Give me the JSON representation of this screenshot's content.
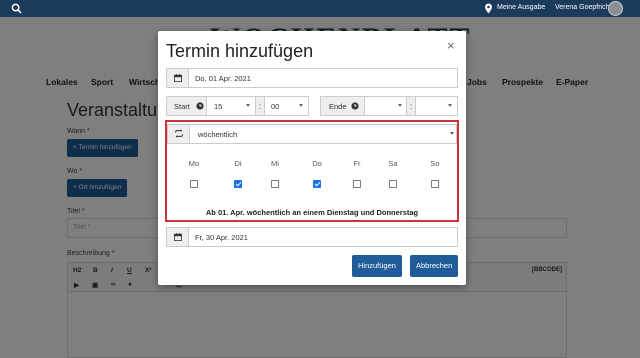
{
  "topbar": {
    "ausgabe": "Meine Ausgabe",
    "user": "Verena Goepfrich"
  },
  "site": {
    "logo": "WOCHENBLATT"
  },
  "nav": [
    "Lokales",
    "Sport",
    "Wirtsch",
    "Jobs",
    "Prospekte",
    "E-Paper"
  ],
  "page": {
    "heading": "Veranstaltu",
    "wann_label": "Wann *",
    "termin_button": "+ Termin hinzufügen",
    "wo_label": "Wo *",
    "ort_button": "+ Ort hinzufügen",
    "titel_label": "Titel *",
    "titel_placeholder": "Titel *",
    "beschreibung_label": "Beschreibung *",
    "editor": {
      "h2": "H2",
      "bold": "B",
      "italic": "I",
      "underline": "U",
      "superscript": "X²",
      "bbcode": "[BBCODE]"
    }
  },
  "modal": {
    "title": "Termin hinzufügen",
    "close": "×",
    "date": "Do, 01 Apr. 2021",
    "start_label": "Start",
    "start_hour": "15",
    "start_minute": "00",
    "time_sep": ":",
    "end_label": "Ende",
    "end_hour": "",
    "end_minute": "",
    "recurrence": "wöchentlich",
    "days": [
      {
        "label": "Mo",
        "checked": false
      },
      {
        "label": "Di",
        "checked": true
      },
      {
        "label": "Mi",
        "checked": false
      },
      {
        "label": "Do",
        "checked": true
      },
      {
        "label": "Fr",
        "checked": false
      },
      {
        "label": "Sa",
        "checked": false
      },
      {
        "label": "So",
        "checked": false
      }
    ],
    "summary": "Ab 01. Apr. wöchentlich an einem Dienstag und Donnerstag",
    "end_date": "Fr, 30 Apr. 2021",
    "add_button": "Hinzufügen",
    "cancel_button": "Abbrechen"
  },
  "colors": {
    "topbar": "#1b3a5c",
    "primary": "#1f5c99",
    "highlight": "#d0323a",
    "checked": "#1a73e8"
  }
}
